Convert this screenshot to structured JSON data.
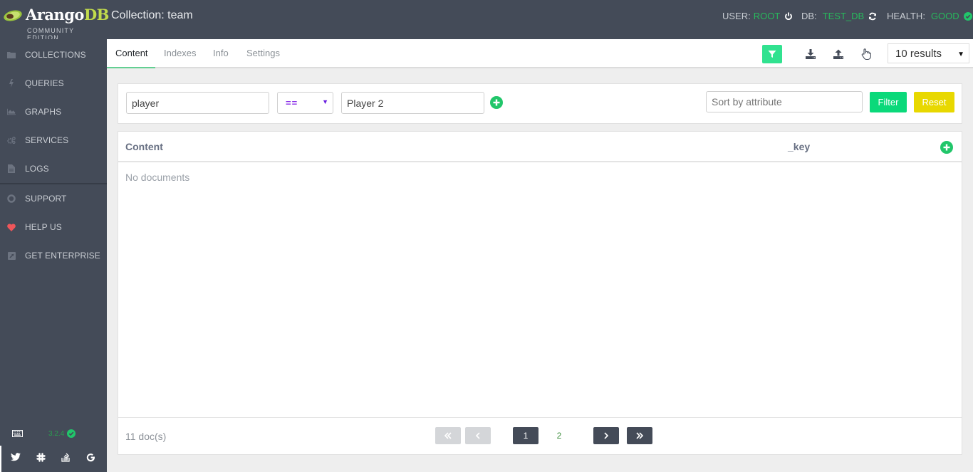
{
  "header": {
    "logo_name": "Arango",
    "logo_db": "DB",
    "logo_edition": "COMMUNITY EDITION",
    "collection_title": "Collection: team",
    "user_label": "USER:",
    "user_value": "ROOT",
    "db_label": "DB:",
    "db_value": "TEST_DB",
    "health_label": "HEALTH:",
    "health_value": "GOOD"
  },
  "sidebar": {
    "items": [
      {
        "label": "COLLECTIONS",
        "icon": "folder-icon"
      },
      {
        "label": "QUERIES",
        "icon": "bolt-icon"
      },
      {
        "label": "GRAPHS",
        "icon": "area-chart-icon"
      },
      {
        "label": "SERVICES",
        "icon": "cogs-icon"
      },
      {
        "label": "LOGS",
        "icon": "file-text-icon"
      },
      {
        "label": "SUPPORT",
        "icon": "life-ring-icon"
      },
      {
        "label": "HELP US",
        "icon": "heart-icon"
      },
      {
        "label": "GET ENTERPRISE",
        "icon": "external-link-icon"
      }
    ],
    "version": "3.2.4",
    "social": [
      "twitter-icon",
      "slack-icon",
      "stackoverflow-icon",
      "google-icon"
    ]
  },
  "subnav": {
    "tabs": [
      {
        "label": "Content",
        "active": true
      },
      {
        "label": "Indexes",
        "active": false
      },
      {
        "label": "Info",
        "active": false
      },
      {
        "label": "Settings",
        "active": false
      }
    ],
    "results_select": "10 results"
  },
  "filter": {
    "attribute_value": "player",
    "operator": "==",
    "value": "Player 2",
    "sort_placeholder": "Sort by attribute",
    "filter_button": "Filter",
    "reset_button": "Reset"
  },
  "documents": {
    "columns": [
      "Content",
      "_key"
    ],
    "empty_message": "No documents",
    "count_text": "11 doc(s)",
    "pages": [
      "1",
      "2"
    ],
    "current_page": "2"
  },
  "colors": {
    "header_bg": "#444b58",
    "accent_green": "#31e290",
    "reset_yellow": "#e8d800",
    "status_green": "#28b85c",
    "heart_red": "#f0565a"
  }
}
